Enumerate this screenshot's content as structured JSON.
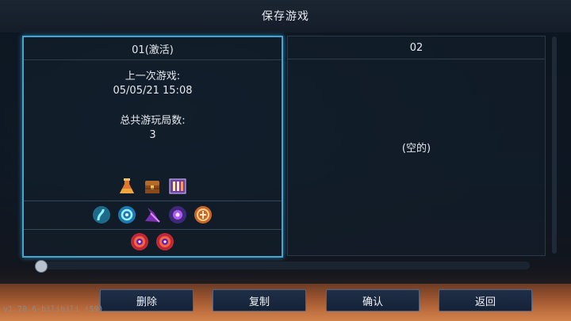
{
  "window": {
    "title": "保存游戏"
  },
  "slots": [
    {
      "header": "01(激活)",
      "last_game_label": "上一次游戏:",
      "last_game_value": "05/05/21 15:08",
      "total_runs_label": "总共游玩局数:",
      "total_runs_value": "3",
      "item_icons_row1": [
        "flask-icon",
        "chest-icon",
        "rune-icon"
      ],
      "item_icons_row2": [
        "tentacle-icon",
        "swirl-icon",
        "claw-icon",
        "eye-icon",
        "shield-rune-icon"
      ],
      "item_icons_row3": [
        "boss-cell-icon",
        "boss-cell-icon"
      ]
    },
    {
      "header": "02",
      "empty_label": "(空的)"
    }
  ],
  "buttons": {
    "delete": "删除",
    "copy": "复制",
    "confirm": "确认",
    "back": "返回"
  },
  "footer": {
    "version": "v1.70.6-bilibili (59)"
  },
  "colors": {
    "active_border": "#3fa6d6",
    "button_bg": "#1f2f47"
  }
}
